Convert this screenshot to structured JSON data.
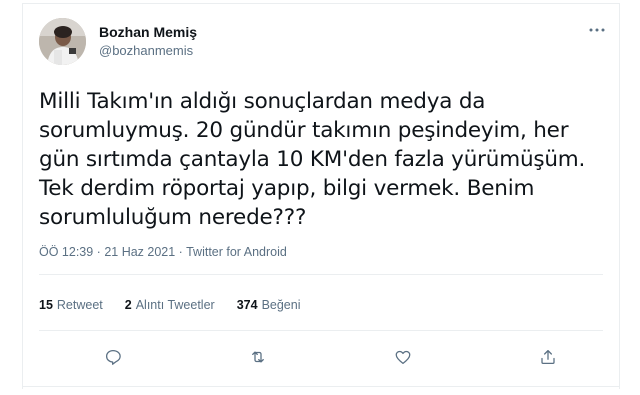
{
  "author": {
    "name": "Bozhan Memiş",
    "handle": "@bozhanmemis"
  },
  "tweet": {
    "text": "Milli Takım'ın aldığı sonuçlardan medya da sorumluymuş. 20 gündür takımın peşindeyim, her gün sırtımda çantayla 10 KM'den fazla yürümüşüm. Tek derdim röportaj yapıp, bilgi vermek. Benim sorumluluğum nerede???"
  },
  "meta": {
    "time": "ÖÖ 12:39",
    "separator1": " · ",
    "date": "21 Haz 2021",
    "separator2": " · ",
    "source": "Twitter for Android"
  },
  "stats": {
    "retweets_count": "15",
    "retweets_label": "Retweet",
    "quotes_count": "2",
    "quotes_label": "Alıntı Tweetler",
    "likes_count": "374",
    "likes_label": "Beğeni"
  },
  "icons": {
    "more": "more-horizontal-icon",
    "reply": "reply-icon",
    "retweet": "retweet-icon",
    "like": "heart-icon",
    "share": "share-icon"
  },
  "colors": {
    "text": "#0f1419",
    "secondary": "#5b7083",
    "divider": "#ebeef0"
  }
}
